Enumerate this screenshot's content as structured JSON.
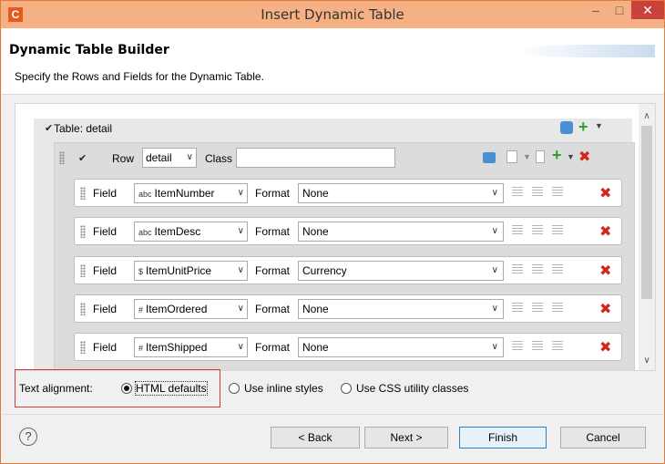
{
  "window": {
    "title": "Insert Dynamic Table",
    "app_icon": "C"
  },
  "controls": {
    "minimize": "–",
    "maximize": "□",
    "close": "✕"
  },
  "header": {
    "title": "Dynamic Table Builder",
    "subtitle": "Specify the Rows and Fields for the Dynamic Table."
  },
  "table": {
    "label": "Table: detail"
  },
  "row": {
    "label": "Row",
    "value": "detail",
    "class_label": "Class",
    "class_value": ""
  },
  "fields": [
    {
      "label": "Field",
      "type_glyph": "abc",
      "name": "ItemNumber",
      "format_label": "Format",
      "format": "None"
    },
    {
      "label": "Field",
      "type_glyph": "abc",
      "name": "ItemDesc",
      "format_label": "Format",
      "format": "None"
    },
    {
      "label": "Field",
      "type_glyph": "$",
      "name": "ItemUnitPrice",
      "format_label": "Format",
      "format": "Currency"
    },
    {
      "label": "Field",
      "type_glyph": "#",
      "name": "ItemOrdered",
      "format_label": "Format",
      "format": "None"
    },
    {
      "label": "Field",
      "type_glyph": "#",
      "name": "ItemShipped",
      "format_label": "Format",
      "format": "None"
    }
  ],
  "text_alignment": {
    "label": "Text alignment:",
    "options": [
      "HTML defaults",
      "Use inline styles",
      "Use CSS utility classes"
    ],
    "selected": "HTML defaults"
  },
  "buttons": {
    "back": "< Back",
    "next": "Next >",
    "finish": "Finish",
    "cancel": "Cancel"
  },
  "help_glyph": "?"
}
